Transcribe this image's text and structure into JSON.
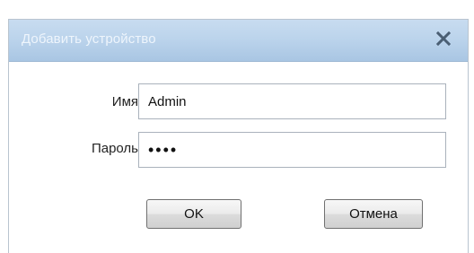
{
  "dialog": {
    "title": "Добавить устройство",
    "close_icon": "close-x-icon"
  },
  "form": {
    "username_label": "Имя",
    "username_value": "Admin",
    "password_label": "Пароль",
    "password_value": "••••"
  },
  "buttons": {
    "ok_label": "OK",
    "cancel_label": "Отмена"
  },
  "colors": {
    "titlebar": "#bcd4ec",
    "title_text": "#eef5fc",
    "close_icon": "#4a5e73"
  }
}
